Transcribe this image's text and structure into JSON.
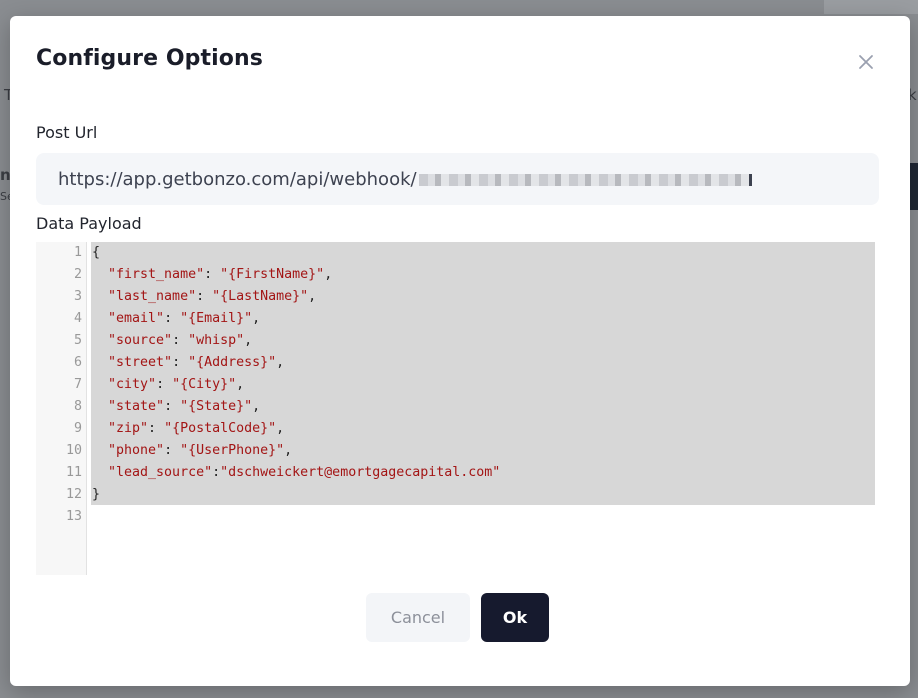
{
  "modal": {
    "title": "Configure Options",
    "close_icon": "close-icon"
  },
  "post_url": {
    "label": "Post Url",
    "value": "https://app.getbonzo.com/api/webhook/"
  },
  "payload": {
    "label": "Data Payload",
    "line_numbers": [
      "1",
      "2",
      "3",
      "4",
      "5",
      "6",
      "7",
      "8",
      "9",
      "10",
      "11",
      "12",
      "13"
    ],
    "lines": [
      "{",
      "  \"first_name\": \"{FirstName}\",",
      "  \"last_name\": \"{LastName}\",",
      "  \"email\": \"{Email}\",",
      "  \"source\": \"whisp\",",
      "  \"street\": \"{Address}\",",
      "  \"city\": \"{City}\",",
      "  \"state\": \"{State}\",",
      "  \"zip\": \"{PostalCode}\",",
      "  \"phone\": \"{UserPhone}\",",
      "  \"lead_source\":\"dschweickert@emortgagecapital.com\"",
      "}",
      ""
    ]
  },
  "buttons": {
    "cancel": "Cancel",
    "ok": "Ok"
  },
  "colors": {
    "primary_button": "#161a2e",
    "json_string": "#a31515",
    "selection_bg": "#d7d7d7"
  }
}
